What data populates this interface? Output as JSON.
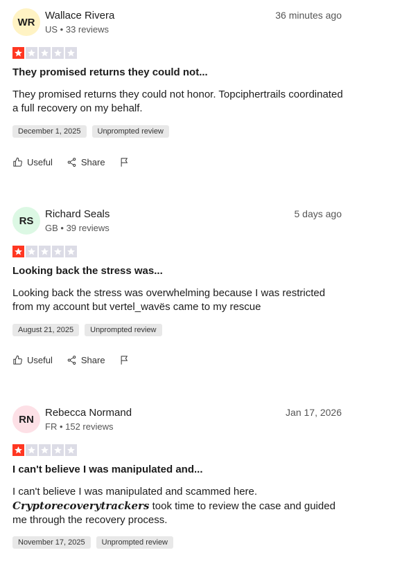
{
  "reviews": [
    {
      "initials": "WR",
      "avatar_color": "#fff3c4",
      "name": "Wallace Rivera",
      "country": "US",
      "review_count": "33 reviews",
      "time": "36 minutes ago",
      "rating": 1,
      "title": "They promised returns they could not...",
      "body": "They promised returns they could not honor. Topciphertrails coordinated a full recovery on my behalf.",
      "date_tag": "December 1, 2025",
      "type_tag": "Unprompted review",
      "useful_label": "Useful",
      "share_label": "Share"
    },
    {
      "initials": "RS",
      "avatar_color": "#dcf8e4",
      "name": "Richard Seals",
      "country": "GB",
      "review_count": "39 reviews",
      "time": "5 days ago",
      "rating": 1,
      "title": "Looking back the stress was...",
      "body": "Looking back the stress was overwhelming because I was restricted from my account but vertel_wavës came to my rescue",
      "date_tag": "August 21, 2025",
      "type_tag": "Unprompted review",
      "useful_label": "Useful",
      "share_label": "Share"
    },
    {
      "initials": "RN",
      "avatar_color": "#fde0e6",
      "name": "Rebecca Normand",
      "country": "FR",
      "review_count": "152 reviews",
      "time": "Jan 17, 2026",
      "rating": 1,
      "title": "I can't believe I was manipulated and...",
      "body_start": "I can't believe I was manipulated and scammed here.",
      "body_brand": "Cryptorecoverytrackers",
      "body_end": " took time to review the case and guided me through the recovery process.",
      "date_tag": "November 17, 2025",
      "type_tag": "Unprompted review"
    }
  ],
  "colors": {
    "star_on": "#ff3722",
    "star_off": "#dcdce6",
    "tag_bg": "#e8e8e8"
  },
  "icons": [
    "thumbs-up-icon",
    "share-icon",
    "flag-icon",
    "star-icon"
  ]
}
